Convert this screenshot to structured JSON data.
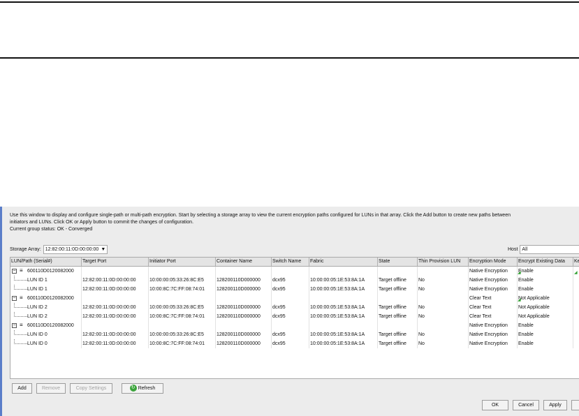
{
  "description_lines": [
    "Use this window to display and configure single-path or multi-path encryption. Start by selecting a storage array to view the current encryption paths configured for LUNs in that array. Click the Add button to create new paths between",
    "initiators and LUNs. Click OK or Apply button to commit the changes of configuration.",
    "Current group status: OK - Converged"
  ],
  "storage_array": {
    "label": "Storage Array",
    "value": "12:82:00:11:0D:00:00:00"
  },
  "host": {
    "label": "Host",
    "value": "All"
  },
  "table": {
    "columns": [
      "LUN/Path (Serial#)",
      "Target Port",
      "Initiator Port",
      "Container Name",
      "Switch Name",
      "Fabric",
      "State",
      "Thin Provision LUN",
      "Encryption Mode",
      "Encrypt Existing Data",
      "Ke"
    ],
    "rows": [
      {
        "type": "lun",
        "cells": [
          "600110D0120082000",
          "",
          "",
          "",
          "",
          "",
          "",
          "",
          "Native Encryption",
          "Enable",
          ""
        ]
      },
      {
        "type": "path",
        "cells": [
          "LUN ID 1",
          "12:82:00:11:0D:00:00:00",
          "10:00:00:05:33:26:8C:E5",
          "128200110D000000",
          "dcx95",
          "10:00:00:05:1E:53:8A:1A",
          "Target offline",
          "No",
          "Native Encryption",
          "Enable",
          ""
        ]
      },
      {
        "type": "path",
        "cells": [
          "LUN ID 1",
          "12:82:00:11:0D:00:00:00",
          "10:00:8C:7C:FF:08:74:01",
          "128200110D000000",
          "dcx95",
          "10:00:00:05:1E:53:8A:1A",
          "Target offline",
          "No",
          "Native Encryption",
          "Enable",
          ""
        ]
      },
      {
        "type": "lun",
        "cells": [
          "600110D0120082000",
          "",
          "",
          "",
          "",
          "",
          "",
          "",
          "Clear Text",
          "Not Applicable",
          ""
        ]
      },
      {
        "type": "path",
        "cells": [
          "LUN ID 2",
          "12:82:00:11:0D:00:00:00",
          "10:00:00:05:33:26:8C:E5",
          "128200110D000000",
          "dcx95",
          "10:00:00:05:1E:53:8A:1A",
          "Target offline",
          "No",
          "Clear Text",
          "Not Applicable",
          ""
        ]
      },
      {
        "type": "path",
        "cells": [
          "LUN ID 2",
          "12:82:00:11:0D:00:00:00",
          "10:00:8C:7C:FF:08:74:01",
          "128200110D000000",
          "dcx95",
          "10:00:00:05:1E:53:8A:1A",
          "Target offline",
          "No",
          "Clear Text",
          "Not Applicable",
          ""
        ]
      },
      {
        "type": "lun",
        "cells": [
          "600110D0120082000",
          "",
          "",
          "",
          "",
          "",
          "",
          "",
          "Native Encryption",
          "Enable",
          ""
        ]
      },
      {
        "type": "path",
        "cells": [
          "LUN ID 0",
          "12:82:00:11:0D:00:00:00",
          "10:00:00:05:33:26:8C:E5",
          "128200110D000000",
          "dcx95",
          "10:00:00:05:1E:53:8A:1A",
          "Target offline",
          "No",
          "Native Encryption",
          "Enable",
          ""
        ]
      },
      {
        "type": "path",
        "cells": [
          "LUN ID 0",
          "12:82:00:11:0D:00:00:00",
          "10:00:8C:7C:FF:08:74:01",
          "128200110D000000",
          "dcx95",
          "10:00:00:05:1E:53:8A:1A",
          "Target offline",
          "No",
          "Native Encryption",
          "Enable",
          ""
        ]
      }
    ]
  },
  "buttons": {
    "add": "Add",
    "remove": "Remove",
    "copy_settings": "Copy Settings",
    "refresh": "Refresh",
    "ok": "OK",
    "cancel": "Cancel",
    "apply": "Apply",
    "help": "H"
  },
  "colors": {
    "accent": "#5b7ec9",
    "marker": "#2f9d2f"
  }
}
